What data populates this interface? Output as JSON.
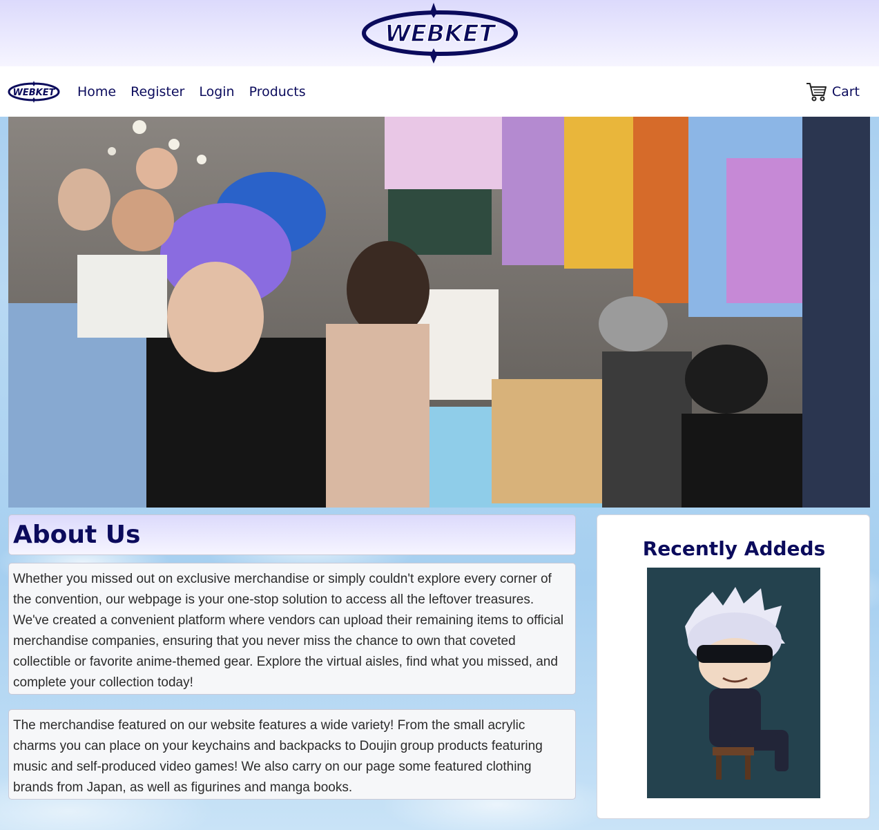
{
  "brand": {
    "logo_text": "WEBKET"
  },
  "navbar": {
    "links": [
      "Home",
      "Register",
      "Login",
      "Products"
    ],
    "cart_label": "Cart"
  },
  "about": {
    "title": "About Us",
    "paragraph1": "Whether you missed out on exclusive merchandise or simply couldn't explore every corner of the convention, our webpage is your one-stop solution to access all the leftover treasures. We've created a convenient platform where vendors can upload their remaining items to official merchandise companies, ensuring that you never miss the chance to own that coveted collectible or favorite anime-themed gear. Explore the virtual aisles, find what you missed, and complete your collection today!",
    "paragraph2": "The merchandise featured on our website features a wide variety! From the small acrylic charms you can place on your keychains and backpacks to Doujin group products featuring music and self-produced video games! We also carry on our page some featured clothing brands from Japan, as well as figurines and manga books."
  },
  "recently_added": {
    "title": "Recently Addeds"
  },
  "colors": {
    "brand_navy": "#0b0b5c",
    "banner_lavender": "#dcdafc"
  }
}
